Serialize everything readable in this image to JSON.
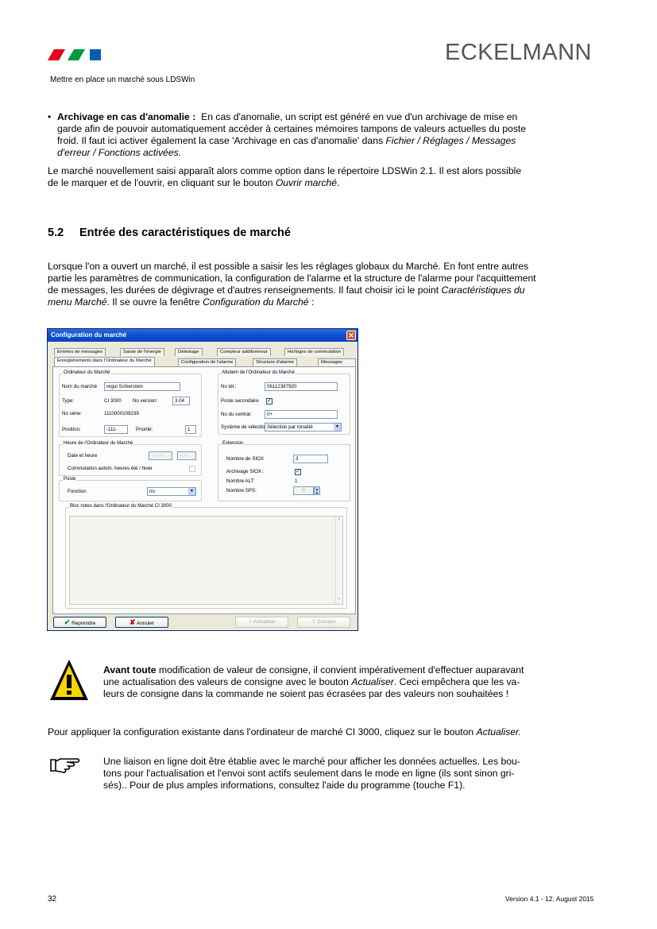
{
  "header": {
    "brand": "ECKELMANN",
    "subtitle": "Mettre en place un marché sous LDSWin"
  },
  "body": {
    "bullet_term": "Archivage en cas d'anomalie :",
    "bullet_text_1": "En cas d'anomalie, un script est généré en vue d'un archivage de mise en",
    "bullet_text_2": "garde afin de pouvoir automatiquement accéder à certaines mémoires tampons de valeurs actuelles du poste",
    "bullet_text_3": "froid. Il faut ici activer également la case 'Archivage en cas d'anomalie' dans",
    "bullet_path_1": "Fichier / Réglages / Messages",
    "bullet_path_2": "d'erreur / Fonctions activées.",
    "p1_line1": "Le marché nouvellement saisi apparaît alors comme option dans le répertoire LDSWin 2.1. Il est alors possible",
    "p1_line2_a": "de le marquer et de l'ouvrir, en cliquant sur le bouton",
    "p1_line2_i": "Ouvrir marché",
    "p1_line2_b": ".",
    "section_number": "5.2",
    "section_title": "Entrée des caractéristiques de marché",
    "p2_line1": "Lorsque l'on a ouvert un marché, il est possible a saisir les les réglages globaux du Marché. En font entre autres",
    "p2_line2": "partie les paramètres de communication, la configuration de l'alarme et la structure de l'alarme pour l'acquittement",
    "p2_line3_a": "de messages, les durées de dégivrage et d'autres renseignements. Il faut choisir ici le point",
    "p2_line3_i": "Caractéristiques du",
    "p2_line4_i": "menu Marché",
    "p2_line4_a": ". Il se ouvre la fenêtre",
    "p2_line4_i2": "Configuration du Marché",
    "p2_line4_b": " :",
    "warn_bold": "Avant toute",
    "warn_line1": " modification de valeur de consigne, il convient impérativement d'effectuer auparavant",
    "warn_line2_a": "une actualisation des valeurs de consigne avec le bouton",
    "warn_line2_i": "Actualiser",
    "warn_line2_b": ". Ceci empêchera que les va-",
    "warn_line3": "leurs de consigne dans la commande ne  soient pas écrasées par des valeurs non souhaitées !",
    "p3_a": "Pour appliquer la configuration existante dans l'ordinateur de marché CI 3000, cliquez sur le bouton",
    "p3_i": "Actualiser.",
    "note_line1": "Une liaison en ligne doit être établie avec le marché pour afficher les données actuelles. Les bou-",
    "note_line2": "tons pour l'actualisation et l'envoi sont actifs seulement dans le mode en ligne (ils sont sinon gri-",
    "note_line3": "sés).. Pour de plus amples informations, consultez l'aide du programme (touche F1)."
  },
  "dialog": {
    "title": "Configuration du marché",
    "tabs_row1": [
      "Entrées de messages",
      "Saisie de l'énergie",
      "Délestage",
      "Compteur additionneur",
      "Horloges de commutation"
    ],
    "tabs_row2": [
      "Enregistrements dans l'Ordinateur du Marché",
      "Configuration de l'alarme",
      "Structure d'alarme",
      "Messages"
    ],
    "grp_ordinateur": "Ordinateur du Marché",
    "nom_label": "Nom du marché",
    "nom_value": "regul Schierstein",
    "type_label": "Type:",
    "type_value": "CI 3000",
    "noversion_label": "No version:",
    "noversion_value": "3.04",
    "noserie_label": "No série:",
    "noserie_value": "1110000109239",
    "position_label": "Position:",
    "position_value": "-111-",
    "priorite_label": "Priorité:",
    "priorite_value": "1",
    "grp_modem": "Modem de l'Ordinateur du Marché",
    "notel_label": "No tél.:",
    "notel_value": "06112387920",
    "poste_label": "Poste secondaire",
    "nocentral_label": "No du central:",
    "nocentral_value": "0+",
    "systeme_label": "Système de sélectio",
    "systeme_value": "Sélection par tonalité",
    "grp_heure": "Heure de l'Ordinateur du Marché",
    "date_label": "Date et heure",
    "date_value": "--.--.--",
    "time_value": "--:--",
    "commut_label": "Commutation autom. heures été / hiver",
    "grp_poste": "Poste",
    "fonction_label": "Fonction",
    "fonction_value": "no",
    "grp_extension": "Extension",
    "siox_label": "Nombre de SIOX",
    "siox_value": "3",
    "archsiox_label": "Archivage SIOX :",
    "alt_label": "Nombre ALT:",
    "alt_value": "1",
    "sps_label": "Nombre SPS:",
    "sps_value": "0",
    "grp_notes": "Bloc notes dans l'Ordinateur du Marché CI 3000",
    "btn_reprendre": "Reprendre",
    "btn_annuler": "Annuler",
    "btn_actualiser": "Actualiser",
    "btn_envoyer": "Envoyer"
  },
  "footer": {
    "page": "32",
    "version": "Version 4.1 -  12. August 2015"
  },
  "colors": {
    "logo_red": "#e3001b",
    "logo_green": "#009a3a",
    "logo_blue": "#005faf"
  }
}
